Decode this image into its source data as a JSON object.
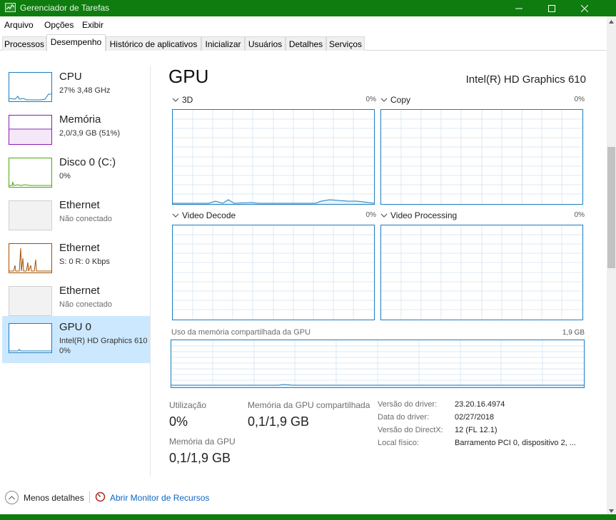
{
  "window": {
    "title": "Gerenciador de Tarefas"
  },
  "menu": {
    "items": [
      "Arquivo",
      "Opções",
      "Exibir"
    ]
  },
  "tabs": [
    "Processos",
    "Desempenho",
    "Histórico de aplicativos",
    "Inicializar",
    "Usuários",
    "Detalhes",
    "Serviços"
  ],
  "active_tab": "Desempenho",
  "sidebar": {
    "items": [
      {
        "name": "CPU",
        "sub": "27%  3,48 GHz",
        "sub2": "",
        "color": "#1a7dc0"
      },
      {
        "name": "Memória",
        "sub": "2,0/3,9 GB (51%)",
        "sub2": "",
        "color": "#8b1ab5"
      },
      {
        "name": "Disco 0 (C:)",
        "sub": "0%",
        "sub2": "",
        "color": "#4da60c"
      },
      {
        "name": "Ethernet",
        "sub": "Não conectado",
        "sub2": "",
        "color": "#bdbdbd"
      },
      {
        "name": "Ethernet",
        "sub": "S: 0  R: 0 Kbps",
        "sub2": "",
        "color": "#a74f01"
      },
      {
        "name": "Ethernet",
        "sub": "Não conectado",
        "sub2": "",
        "color": "#bdbdbd"
      },
      {
        "name": "GPU 0",
        "sub": "Intel(R) HD Graphics 610",
        "sub2": "0%",
        "color": "#1a7dc0"
      }
    ]
  },
  "main": {
    "title": "GPU",
    "adapter": "Intel(R) HD Graphics 610",
    "graphs": [
      {
        "label": "3D",
        "pct": "0%"
      },
      {
        "label": "Copy",
        "pct": "0%"
      },
      {
        "label": "Video Decode",
        "pct": "0%"
      },
      {
        "label": "Video Processing",
        "pct": "0%"
      }
    ],
    "shared_memory": {
      "label": "Uso da memória compartilhada da GPU",
      "max": "1,9 GB"
    },
    "stats": {
      "utilization_label": "Utilização",
      "utilization_value": "0%",
      "shared_mem_label": "Memória da GPU compartilhada",
      "shared_mem_value": "0,1/1,9 GB",
      "gpu_mem_label": "Memória da GPU",
      "gpu_mem_value": "0,1/1,9 GB"
    },
    "info": [
      {
        "label": "Versão do driver:",
        "value": "23.20.16.4974"
      },
      {
        "label": "Data do driver:",
        "value": "02/27/2018"
      },
      {
        "label": "Versão do DirectX:",
        "value": "12 (FL 12.1)"
      },
      {
        "label": "Local físico:",
        "value": "Barramento PCI 0, dispositivo 2, ..."
      }
    ]
  },
  "footer": {
    "less_details": "Menos detalhes",
    "open_monitor": "Abrir Monitor de Recursos"
  }
}
